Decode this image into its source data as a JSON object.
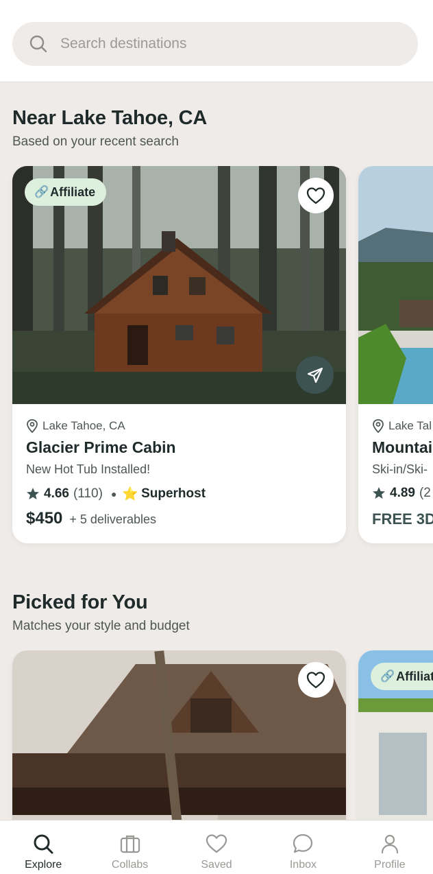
{
  "search": {
    "placeholder": "Search destinations",
    "icon": "search-icon"
  },
  "sections": [
    {
      "title": "Near Lake Tahoe, CA",
      "subtitle": "Based on your recent search",
      "cards": [
        {
          "badge": "Affiliate",
          "location": "Lake Tahoe, CA",
          "name": "Glacier Prime Cabin",
          "tagline": "New Hot Tub Installed!",
          "rating": "4.66",
          "reviews": "(110)",
          "host_badge": "Superhost",
          "price": "$450",
          "extra": "+ 5 deliverables"
        },
        {
          "location": "Lake Tal",
          "name": "Mountai",
          "tagline": "Ski-in/Ski-",
          "rating": "4.89",
          "reviews": "(2",
          "price_label": "FREE 3D"
        }
      ]
    },
    {
      "title": "Picked for You",
      "subtitle": "Matches your style and budget",
      "cards": [
        {},
        {
          "badge": "Affiliat"
        }
      ]
    }
  ],
  "nav": [
    {
      "label": "Explore",
      "icon": "search-icon",
      "active": true
    },
    {
      "label": "Collabs",
      "icon": "briefcase-icon",
      "active": false
    },
    {
      "label": "Saved",
      "icon": "heart-icon",
      "active": false
    },
    {
      "label": "Inbox",
      "icon": "chat-bubble-icon",
      "active": false
    },
    {
      "label": "Profile",
      "icon": "person-icon",
      "active": false
    }
  ],
  "colors": {
    "background": "#efebe8",
    "badge": "#dcf0dd",
    "share_button": "#3d5352",
    "text_primary": "#1f2a2a"
  }
}
